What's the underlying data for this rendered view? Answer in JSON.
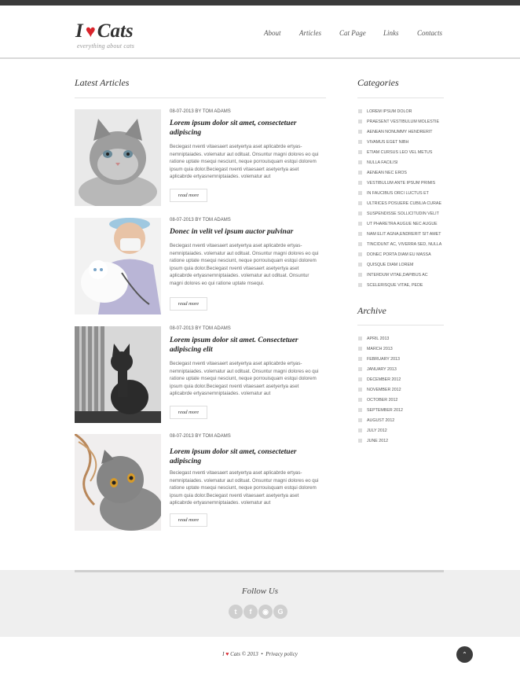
{
  "brand": {
    "logo_text_i": "I",
    "logo_heart": "♥",
    "logo_text_cats": "Cats",
    "tagline": "everything about cats"
  },
  "nav": {
    "about": "About",
    "articles": "Articles",
    "cat_page": "Cat Page",
    "links": "Links",
    "contacts": "Contacts"
  },
  "main": {
    "title": "Latest Articles",
    "articles": [
      {
        "meta": "08-07-2013 BY TOM ADAMS",
        "title": "Lorem ipsum dolor sit amet, consectetuer adipiscing",
        "body": "Beciegast nventi vitaesaert asetyertya aset aplicabrde ertyas-nemniptaiades. volematur aut odituat. Onsuntur magni dolores eo qui ratione uptate msequi nesciunt, neque porrouisquam estqui dolorem ipsum quia dolor.Beciegast nventi vitaesaert asetyertya aset aplicabrde ertyasnemniptaiades. volematur aut",
        "read_more": "read more",
        "image_icon": "kitten-photo"
      },
      {
        "meta": "08-07-2013 BY TOM ADAMS",
        "title": "Donec in velit vel ipsum auctor pulvinar",
        "body": "Beciegast nventi vitaesaert asetyertya aset aplicabrde ertyas-nemniptaiades. volematur aut odituat. Onsuntur magni dolores eo qui ratione uptate msequi nesciunt, neque porrouisquam estqui dolorem ipsum quia dolor.Beciegast nventi vitaesaert asetyertya aset aplicabrde ertyasnemniptaiades. volematur aut odituat. Onsuntur magni dolores eo qui ratione uptate msequi.",
        "read_more": "read more",
        "image_icon": "vet-with-cat-photo"
      },
      {
        "meta": "08-07-2013 BY TOM ADAMS",
        "title": "Lorem ipsum dolor sit amet. Consectetuer adipiscing elit",
        "body": "Beciegast nventi vitaesaert asetyertya aset aplicabrde ertyas-nemniptaiades. volematur aut odituat. Onsuntur magni dolores eo qui ratione uptate msequi nesciunt, neque porrouisquam estqui dolorem ipsum quia dolor.Beciegast nventi vitaesaert asetyertya aset aplicabrde ertyasnemniptaiades. volematur aut",
        "read_more": "read more",
        "image_icon": "black-cat-photo"
      },
      {
        "meta": "08-07-2013 BY TOM ADAMS",
        "title": "Lorem ipsum dolor sit amet, consectetuer adipiscing",
        "body": "Beciegast nventi vitaesaert asetyertya aset aplicabrde ertyas-nemniptaiades. volematur aut odituat. Onsuntur magni dolores eo qui ratione uptate msequi nesciunt, neque porrouisquam estqui dolorem ipsum quia dolor.Beciegast nventi vitaesaert asetyertya aset aplicabrde ertyasnemniptaiades. volematur aut",
        "read_more": "read more",
        "image_icon": "grey-cat-photo"
      }
    ]
  },
  "sidebar": {
    "categories_title": "Categories",
    "categories": [
      "LOREM IPSUM DOLOR",
      "PRAESENT VESTIBULUM MOLESTIE",
      "AENEAN NONUMMY HENDRERIT",
      "VIVAMUS EGET NIBH",
      "ETIAM CURSUS LEO VEL METUS",
      "NULLA FACILISI",
      "AENEAN NEC EROS",
      "VESTIBULUM ANTE IPSUM PRIMIS",
      "IN FAUCIBUS ORCI LUCTUS ET",
      "ULTRICES POSUERE CUBILIA CURAE",
      "SUSPENDISSE SOLLICITUDIN VELIT",
      "UT PHARETRA AUGUE NEC AUGUE",
      "NAM ELIT AGNA,ENDRERIT SIT AMET",
      "TINCIDUNT AC, VIVERRA SED, NULLA",
      "DONEC PORTA DIAM EU MASSA",
      "QUISQUE DIAM LOREM",
      "INTERDUM VITAE,DAPIBUS AC",
      "SCELERISQUE VITAE, PEDE"
    ],
    "archive_title": "Archive",
    "archive": [
      "APRIL 2013",
      "MARCH 2013",
      "FEBRUARY 2013",
      "JANUARY 2013",
      "DECEMBER 2012",
      "NOVEMBER 2012",
      "OCTOBER 2012",
      "SEPTEMBER 2012",
      "AUGUST 2012",
      "JULY 2012",
      "JUNE 2012"
    ]
  },
  "footer": {
    "follow_title": "Follow Us",
    "socials": [
      {
        "name": "twitter-icon",
        "glyph": "t"
      },
      {
        "name": "facebook-icon",
        "glyph": "f"
      },
      {
        "name": "rss-icon",
        "glyph": "◉"
      },
      {
        "name": "google-icon",
        "glyph": "G"
      }
    ],
    "copyright_i": "I",
    "copyright_heart": "♥",
    "copyright_text": "Cats © 2013",
    "separator": "•",
    "privacy": "Privacy policy",
    "to_top_glyph": "⌃"
  }
}
